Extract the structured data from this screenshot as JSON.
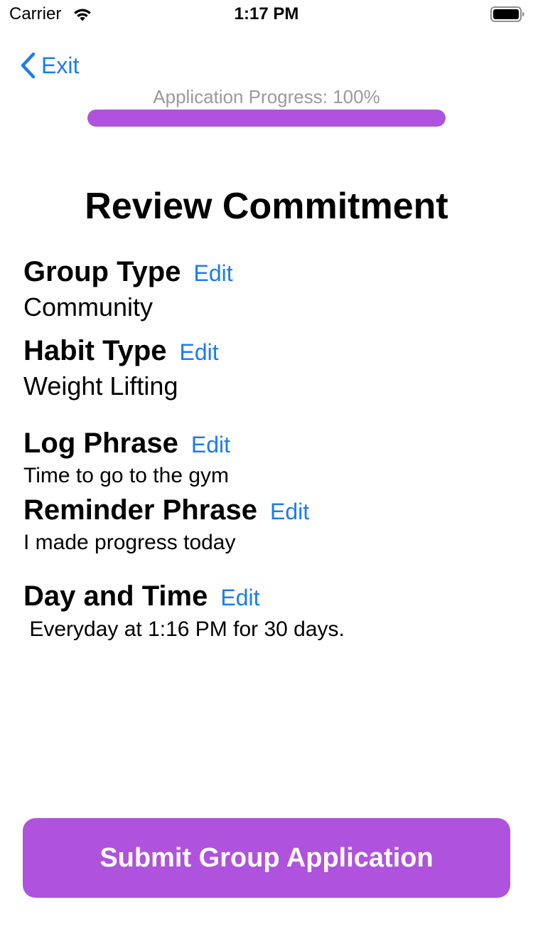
{
  "status_bar": {
    "carrier": "Carrier",
    "time": "1:17 PM",
    "wifi_icon": "wifi-icon",
    "battery_icon": "battery-full-icon"
  },
  "nav": {
    "back_icon": "chevron-left-icon",
    "exit_label": "Exit"
  },
  "progress": {
    "label": "Application Progress: 100%",
    "fraction": 1.0
  },
  "title": "Review Commitment",
  "sections": [
    {
      "heading": "Group Type",
      "edit_label": "Edit",
      "value": "Community"
    },
    {
      "heading": "Habit Type",
      "edit_label": "Edit",
      "value": "Weight Lifting"
    },
    {
      "heading": "Log Phrase",
      "edit_label": "Edit",
      "value": "Time to go to the gym"
    },
    {
      "heading": "Reminder Phrase",
      "edit_label": "Edit",
      "value": "I made progress today"
    },
    {
      "heading": "Day and Time",
      "edit_label": "Edit",
      "value": " Everyday at 1:16 PM for 30 days."
    }
  ],
  "submit_label": "Submit Group Application",
  "colors": {
    "accent": "#af52de",
    "link": "#1a7cf5",
    "progress_label": "#9a9a9a"
  }
}
